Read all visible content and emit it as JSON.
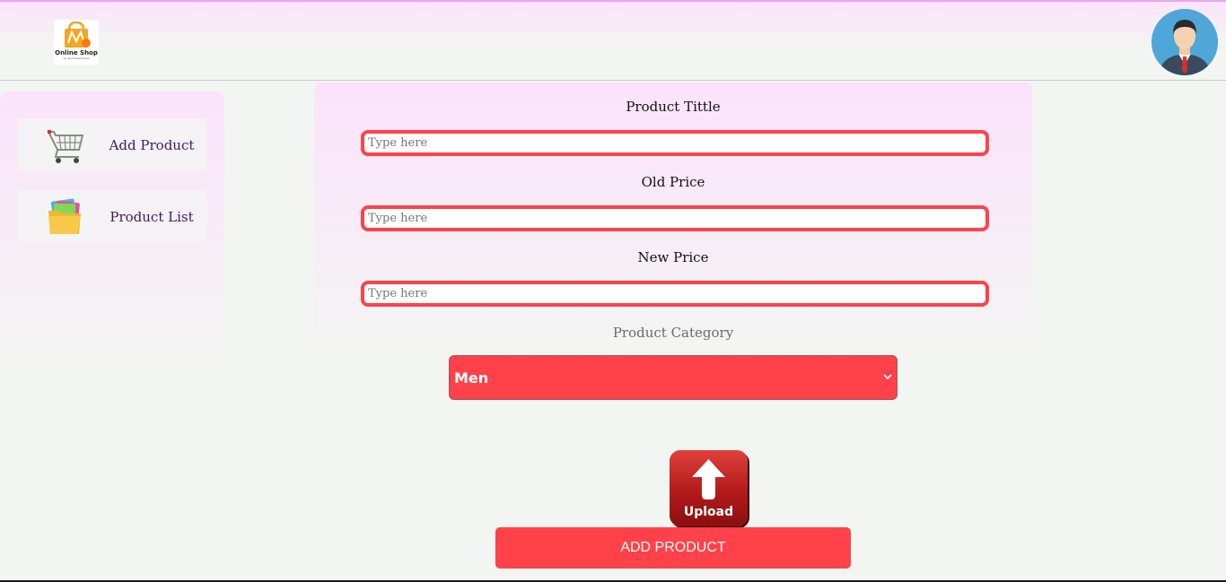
{
  "header": {
    "logo": {
      "icon": "shopping-bag-icon",
      "text": "Online Shop",
      "subtext": "by @onlineshop.bd"
    },
    "avatar_icon": "user-avatar-icon"
  },
  "sidebar": {
    "items": [
      {
        "label": "Add Product",
        "icon": "shopping-cart-icon"
      },
      {
        "label": "Product List",
        "icon": "folder-icon"
      }
    ]
  },
  "form": {
    "title_label": "Product Tittle",
    "title_placeholder": "Type here",
    "old_price_label": "Old Price",
    "old_price_placeholder": "Type here",
    "new_price_label": "New Price",
    "new_price_placeholder": "Type here",
    "category_label": "Product Category",
    "category_value": "Men",
    "upload_label": "Upload",
    "submit_label": "ADD PRODUCT"
  },
  "colors": {
    "accent": "#ff414a",
    "sidebar_text": "#3d1a63",
    "gradient_top": "#fbe3fb",
    "background": "#f3f5f2"
  }
}
